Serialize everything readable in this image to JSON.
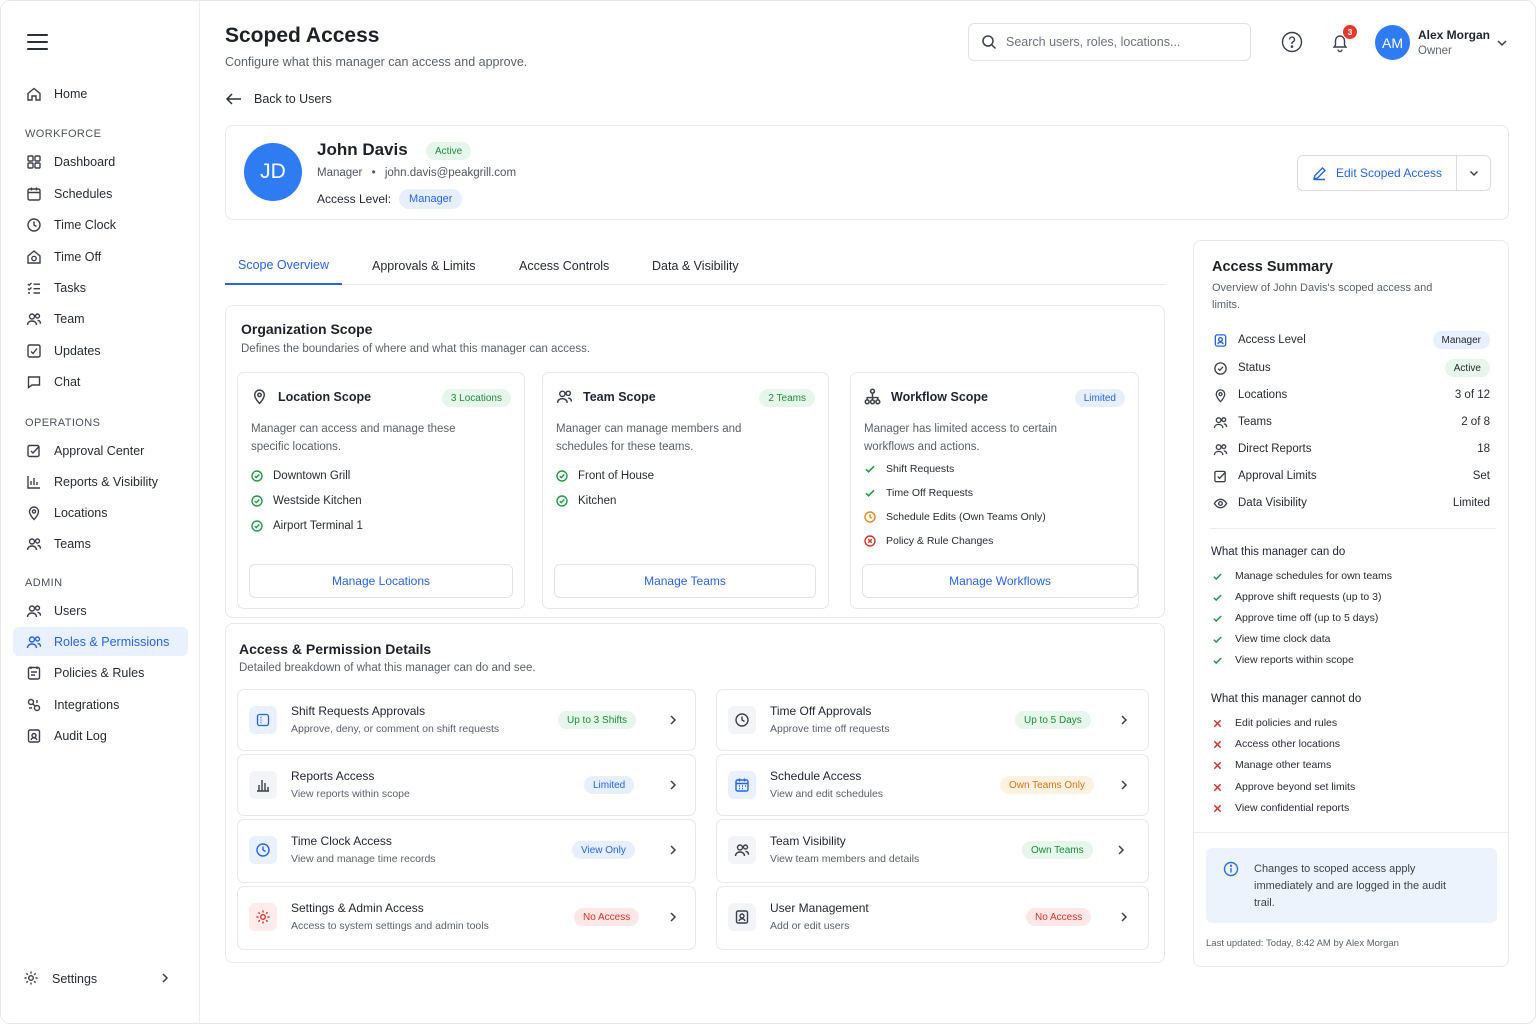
{
  "sidebar": {
    "home": "Home",
    "sections": {
      "workforce": "WORKFORCE",
      "operations": "OPERATIONS",
      "admin": "ADMIN"
    },
    "workforce": [
      "Dashboard",
      "Schedules",
      "Time Clock",
      "Time Off",
      "Tasks",
      "Team",
      "Updates",
      "Chat"
    ],
    "operations": [
      "Approval Center",
      "Reports & Visibility",
      "Locations",
      "Teams"
    ],
    "admin": [
      "Users",
      "Roles & Permissions",
      "Policies & Rules",
      "Integrations",
      "Audit Log"
    ],
    "active_item": "Roles & Permissions",
    "settings": "Settings"
  },
  "header": {
    "title": "Scoped Access",
    "subtitle": "Configure what this manager can access and approve.",
    "search_placeholder": "Search users, roles, locations...",
    "notification_count": "3",
    "user": {
      "initials": "AM",
      "name": "Alex Morgan",
      "role": "Owner"
    },
    "back_label": "Back to Users"
  },
  "profile": {
    "initials": "JD",
    "name": "John Davis",
    "status": "Active",
    "role": "Manager",
    "separator": "•",
    "email": "john.davis@peakgrill.com",
    "access_label": "Access Level:",
    "access_level": "Manager",
    "edit_button": "Edit Scoped Access"
  },
  "tabs": [
    "Scope Overview",
    "Approvals & Limits",
    "Access Controls",
    "Data & Visibility"
  ],
  "active_tab": "Scope Overview",
  "org_scope": {
    "title": "Organization Scope",
    "subtitle": "Defines the boundaries of where and what this manager can access.",
    "cards": [
      {
        "title": "Location Scope",
        "badge": "3 Locations",
        "description": "Manager can access and manage these specific locations.",
        "items": [
          "Downtown Grill",
          "Westside Kitchen",
          "Airport Terminal 1"
        ],
        "button": "Manage Locations"
      },
      {
        "title": "Team Scope",
        "badge": "2 Teams",
        "description": "Manager can manage members and schedules for these teams.",
        "items": [
          "Front of House",
          "Kitchen"
        ],
        "button": "Manage Teams"
      },
      {
        "title": "Workflow Scope",
        "badge": "Limited",
        "description": "Manager has limited access to certain workflows and actions.",
        "items": [
          {
            "label": "Shift Requests",
            "state": "allowed"
          },
          {
            "label": "Time Off Requests",
            "state": "allowed"
          },
          {
            "label": "Schedule Edits (Own Teams Only)",
            "state": "partial"
          },
          {
            "label": "Policy & Rule Changes",
            "state": "denied"
          }
        ],
        "button": "Manage Workflows"
      }
    ]
  },
  "permissions": {
    "title": "Access & Permission Details",
    "subtitle": "Detailed breakdown of what this manager can do and see.",
    "rows": [
      {
        "title": "Shift Requests Approvals",
        "desc": "Approve, deny, or comment on shift requests",
        "badge": "Up to 3 Shifts",
        "badge_color": "green",
        "icon": "shift-request-icon"
      },
      {
        "title": "Time Off Approvals",
        "desc": "Approve time off requests",
        "badge": "Up to 5 Days",
        "badge_color": "green",
        "icon": "clock-icon"
      },
      {
        "title": "Reports Access",
        "desc": "View reports within scope",
        "badge": "Limited",
        "badge_color": "blue",
        "icon": "bar-chart-icon"
      },
      {
        "title": "Schedule Access",
        "desc": "View and edit schedules",
        "badge": "Own Teams Only",
        "badge_color": "orange",
        "icon": "calendar-icon"
      },
      {
        "title": "Time Clock Access",
        "desc": "View and manage time records",
        "badge": "View Only",
        "badge_color": "blue",
        "icon": "clock-icon"
      },
      {
        "title": "Team Visibility",
        "desc": "View team members and details",
        "badge": "Own Teams",
        "badge_color": "green",
        "icon": "users-icon"
      },
      {
        "title": "Settings & Admin Access",
        "desc": "Access to system settings and admin tools",
        "badge": "No Access",
        "badge_color": "red",
        "icon": "gear-icon"
      },
      {
        "title": "User Management",
        "desc": "Add or edit users",
        "badge": "No Access",
        "badge_color": "red",
        "icon": "user-card-icon"
      }
    ]
  },
  "summary": {
    "title": "Access Summary",
    "description": "Overview of John Davis's scoped access and limits.",
    "rows": [
      {
        "label": "Access Level",
        "value": "Manager",
        "style": "blue"
      },
      {
        "label": "Status",
        "value": "Active",
        "style": "green"
      },
      {
        "label": "Locations",
        "value": "3 of 12",
        "style": "text"
      },
      {
        "label": "Teams",
        "value": "2 of 8",
        "style": "text"
      },
      {
        "label": "Direct Reports",
        "value": "18",
        "style": "text"
      },
      {
        "label": "Approval Limits",
        "value": "Set",
        "style": "text"
      },
      {
        "label": "Data Visibility",
        "value": "Limited",
        "style": "text"
      }
    ],
    "can_title": "What this manager can do",
    "can": [
      "Manage schedules for own teams",
      "Approve shift requests (up to 3)",
      "Approve time off (up to 5 days)",
      "View time clock data",
      "View reports within scope"
    ],
    "cannot_title": "What this manager cannot do",
    "cannot": [
      "Edit policies and rules",
      "Access other locations",
      "Manage other teams",
      "Approve beyond set limits",
      "View confidential reports"
    ],
    "info": "Changes to scoped access apply immediately and are logged in the audit trail.",
    "last_updated": "Last updated: Today, 8:42 AM by Alex Morgan"
  },
  "colors": {
    "accent": "#2563eb",
    "success": "#1e8a3e",
    "warning": "#d9730d",
    "danger": "#d5322a"
  }
}
